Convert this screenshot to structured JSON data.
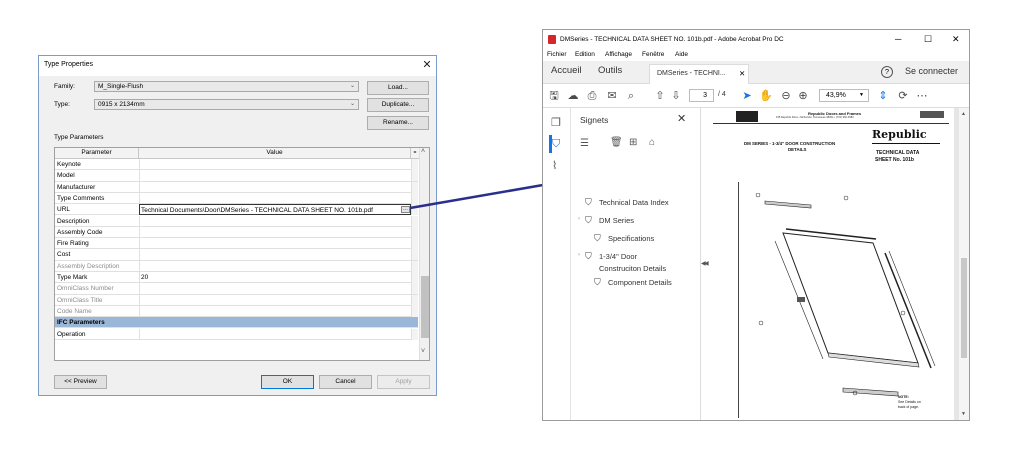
{
  "type_properties": {
    "title": "Type Properties",
    "family_label": "Family:",
    "family_value": "M_Single-Flush",
    "type_label": "Type:",
    "type_value": "0915 x 2134mm",
    "load_btn": "Load...",
    "duplicate_btn": "Duplicate...",
    "rename_btn": "Rename...",
    "section_label": "Type Parameters",
    "col_parameter": "Parameter",
    "col_value": "Value",
    "rows": [
      {
        "k": "Keynote",
        "v": ""
      },
      {
        "k": "Model",
        "v": ""
      },
      {
        "k": "Manufacturer",
        "v": ""
      },
      {
        "k": "Type Comments",
        "v": ""
      },
      {
        "k": "URL",
        "v": "Technical Documents\\Door\\DMSeries - TECHNICAL DATA SHEET NO. 101b.pdf"
      },
      {
        "k": "Description",
        "v": ""
      },
      {
        "k": "Assembly Code",
        "v": ""
      },
      {
        "k": "Fire Rating",
        "v": ""
      },
      {
        "k": "Cost",
        "v": ""
      },
      {
        "k": "Assembly Description",
        "v": ""
      },
      {
        "k": "Type Mark",
        "v": "20"
      },
      {
        "k": "OmniClass Number",
        "v": ""
      },
      {
        "k": "OmniClass Title",
        "v": ""
      },
      {
        "k": "Code Name",
        "v": ""
      },
      {
        "k": "IFC Parameters",
        "v": ""
      },
      {
        "k": "Operation",
        "v": ""
      }
    ],
    "preview_btn": "<< Preview",
    "ok_btn": "OK",
    "cancel_btn": "Cancel",
    "apply_btn": "Apply"
  },
  "acrobat": {
    "window_title": "DMSeries - TECHNICAL DATA SHEET NO. 101b.pdf - Adobe Acrobat Pro DC",
    "menu": [
      "Fichier",
      "Edition",
      "Affichage",
      "Fenêtre",
      "Aide"
    ],
    "home_tab": "Accueil",
    "tools_tab": "Outils",
    "doc_tab": "DMSeries - TECHNI...",
    "signin": "Se connecter",
    "page_current": "3",
    "page_total": "/ 4",
    "zoom": "43,9%",
    "panel_title": "Signets",
    "bookmarks": [
      "Technical Data Index",
      "DM Series",
      "Specifications",
      "1-3/4\" Door",
      "Construciton Details",
      "Component Details"
    ],
    "pdf": {
      "company_name": "Republic Doors and Frames",
      "company_address": "155 Republic Drive • McKenzie, Tennessee 38201 • (731) 352-3383",
      "heading": "DM SERIES - 1-3/4\" DOOR CONSTRUCTION",
      "heading2": "DETAILS",
      "logo": "Republic",
      "tds1": "TECHNICAL DATA",
      "tds2": "SHEET No. 101b",
      "note1": "NOTE:",
      "note2": "See Details on",
      "note3": "back of page."
    }
  }
}
